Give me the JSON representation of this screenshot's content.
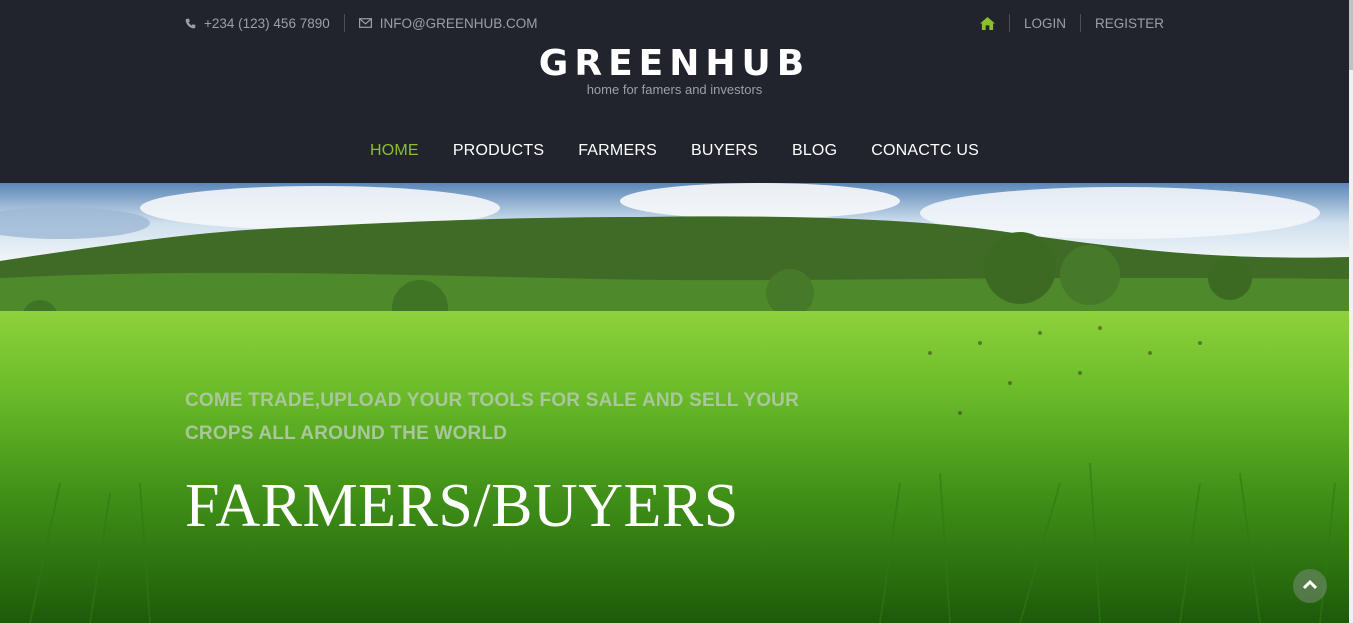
{
  "topbar": {
    "phone": "+234 (123) 456 7890",
    "email": "INFO@GREENHUB.COM",
    "login": "LOGIN",
    "register": "REGISTER"
  },
  "brand": {
    "title": "GREENHUB",
    "tagline": "home for famers and investors"
  },
  "nav": {
    "items": [
      {
        "label": "HOME"
      },
      {
        "label": "PRODUCTS"
      },
      {
        "label": "FARMERS"
      },
      {
        "label": "BUYERS"
      },
      {
        "label": "BLOG"
      },
      {
        "label": "CONACTC US"
      }
    ]
  },
  "hero": {
    "subtitle": "COME TRADE,UPLOAD YOUR TOOLS FOR SALE AND SELL YOUR CROPS ALL AROUND THE WORLD",
    "headline": "FARMERS/BUYERS"
  },
  "colors": {
    "header_bg": "#21242c",
    "accent": "#8cbf2e",
    "muted_text": "#9aa0a8"
  },
  "icons": [
    "phone-icon",
    "envelope-icon",
    "home-icon",
    "chevron-up-icon"
  ]
}
